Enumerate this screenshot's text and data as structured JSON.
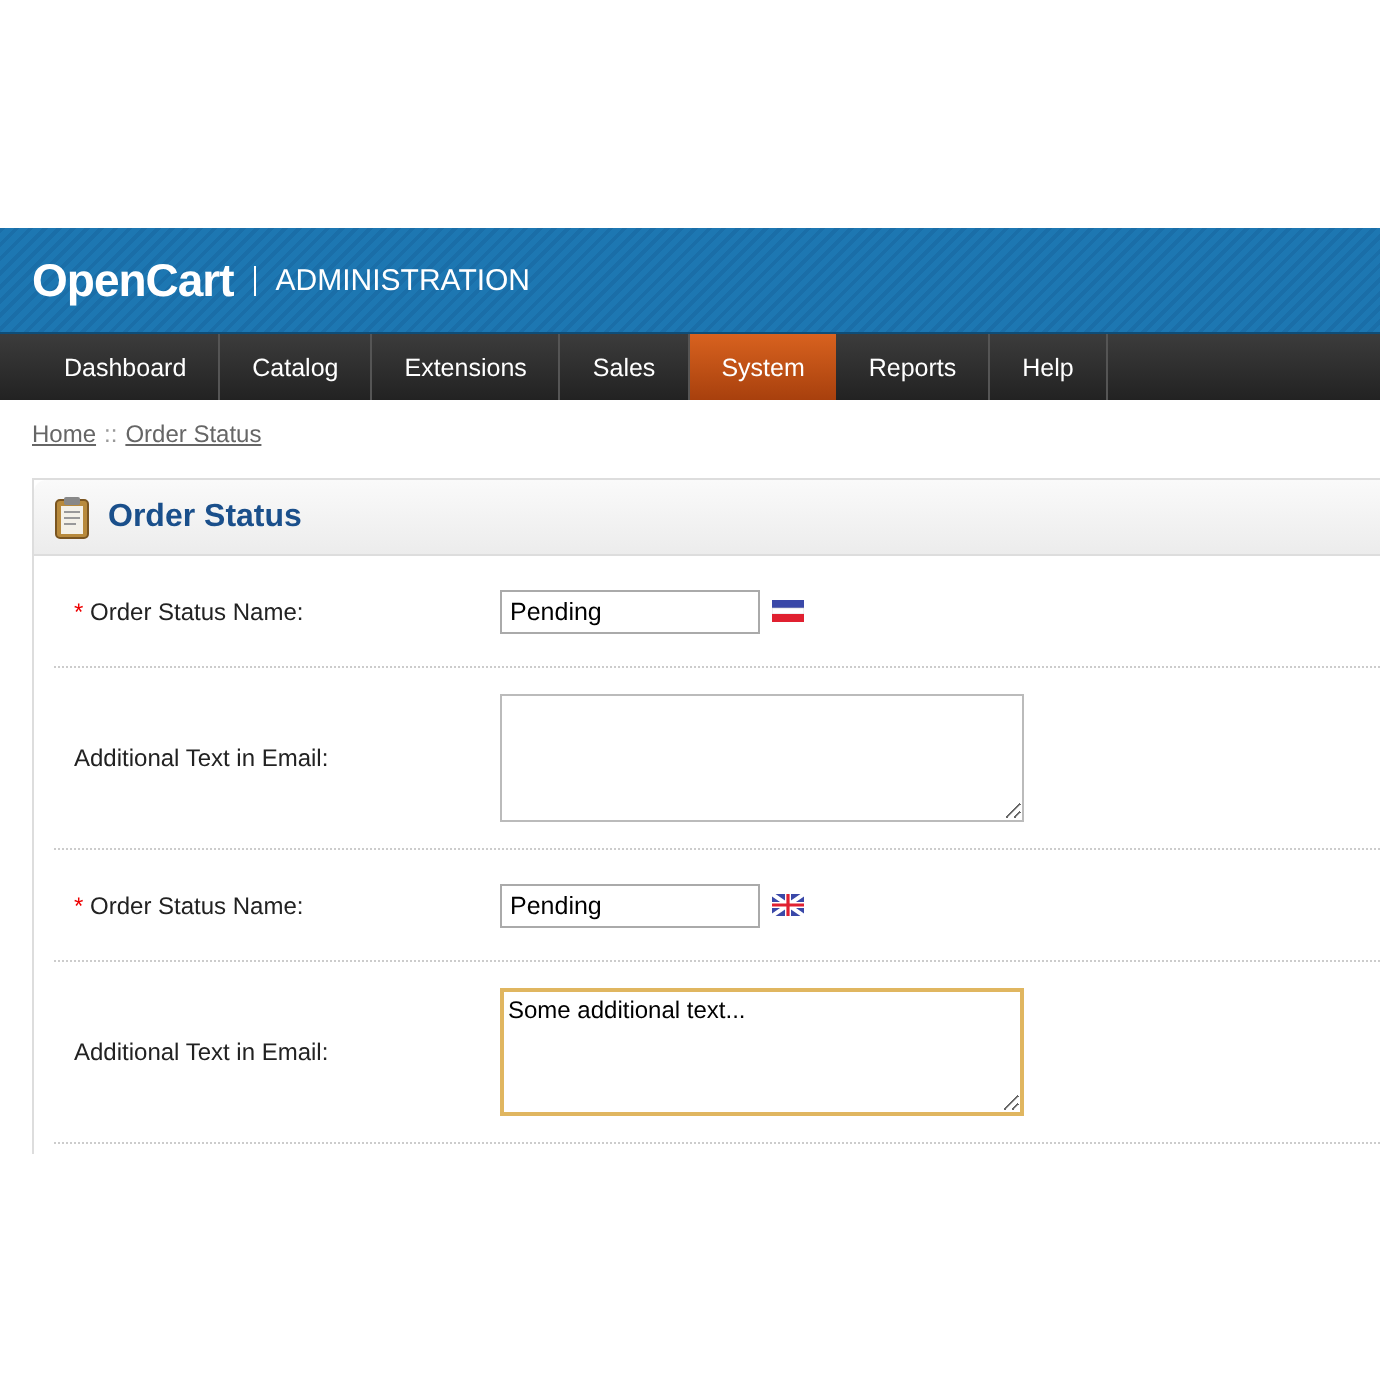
{
  "header": {
    "logo": "OpenCart",
    "title": "ADMINISTRATION"
  },
  "nav": [
    {
      "label": "Dashboard",
      "selected": false
    },
    {
      "label": "Catalog",
      "selected": false
    },
    {
      "label": "Extensions",
      "selected": false
    },
    {
      "label": "Sales",
      "selected": false
    },
    {
      "label": "System",
      "selected": true
    },
    {
      "label": "Reports",
      "selected": false
    },
    {
      "label": "Help",
      "selected": false
    }
  ],
  "breadcrumb": [
    {
      "label": "Home"
    },
    {
      "label": "Order Status"
    }
  ],
  "breadcrumb_separator": "::",
  "panel": {
    "title": "Order Status"
  },
  "rows": [
    {
      "kind": "input",
      "label": "Order Status Name:",
      "required": true,
      "required_mark": "*",
      "value": "Pending",
      "flag": {
        "kind": "striped"
      }
    },
    {
      "kind": "textarea",
      "label": "Additional Text in Email:",
      "value": "",
      "focused": false
    },
    {
      "kind": "input",
      "label": "Order Status Name:",
      "required": true,
      "required_mark": "*",
      "value": "Pending",
      "flag": {
        "kind": "cross"
      }
    },
    {
      "kind": "textarea",
      "label": "Additional Text in Email:",
      "value": "Some additional text...",
      "focused": true
    }
  ]
}
